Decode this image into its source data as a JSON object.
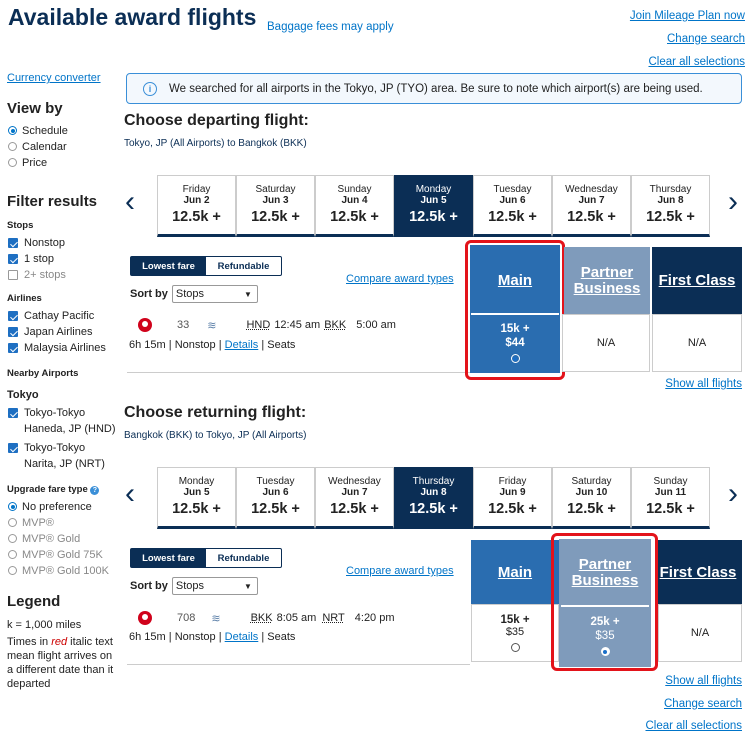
{
  "header": {
    "title": "Available award flights",
    "baggage": "Baggage fees may apply",
    "join": "Join Mileage Plan now",
    "change_search": "Change search",
    "clear": "Clear all selections"
  },
  "sidebar": {
    "currency": "Currency converter",
    "view_by": {
      "title": "View by",
      "options": [
        "Schedule",
        "Calendar",
        "Price"
      ],
      "selected": "Schedule"
    },
    "filter_title": "Filter results",
    "stops": {
      "title": "Stops",
      "options": [
        {
          "label": "Nonstop",
          "checked": true
        },
        {
          "label": "1 stop",
          "checked": true
        },
        {
          "label": "2+ stops",
          "checked": false
        }
      ]
    },
    "airlines": {
      "title": "Airlines",
      "options": [
        {
          "label": "Cathay Pacific",
          "checked": true
        },
        {
          "label": "Japan Airlines",
          "checked": true
        },
        {
          "label": "Malaysia Airlines",
          "checked": true
        }
      ]
    },
    "nearby": {
      "title": "Nearby Airports",
      "city": "Tokyo",
      "options": [
        {
          "label": "Tokyo-Tokyo Haneda, JP (HND)",
          "checked": true
        },
        {
          "label": "Tokyo-Tokyo Narita, JP (NRT)",
          "checked": true
        }
      ]
    },
    "upgrade": {
      "title": "Upgrade fare type",
      "options": [
        "No preference",
        "MVP®",
        "MVP® Gold",
        "MVP® Gold 75K",
        "MVP® Gold 100K"
      ],
      "selected": "No preference"
    },
    "legend": {
      "title": "Legend",
      "k": "k = 1,000 miles",
      "times_a": "Times in ",
      "times_red": "red",
      "times_b": " italic text mean flight arrives on a different date than it departed"
    }
  },
  "notice": "We searched for all airports in the Tokyo, JP (TYO) area. Be sure to note which airport(s) are being used.",
  "departing": {
    "title": "Choose departing flight:",
    "route": "Tokyo, JP (All Airports) to Bangkok (BKK)",
    "dates": [
      {
        "day": "Friday",
        "date": "Jun 2",
        "price": "12.5k +"
      },
      {
        "day": "Saturday",
        "date": "Jun 3",
        "price": "12.5k +"
      },
      {
        "day": "Sunday",
        "date": "Jun 4",
        "price": "12.5k +"
      },
      {
        "day": "Monday",
        "date": "Jun 5",
        "price": "12.5k +"
      },
      {
        "day": "Tuesday",
        "date": "Jun 6",
        "price": "12.5k +"
      },
      {
        "day": "Wednesday",
        "date": "Jun 7",
        "price": "12.5k +"
      },
      {
        "day": "Thursday",
        "date": "Jun 8",
        "price": "12.5k +"
      }
    ],
    "selected_index": 3,
    "toggle": [
      "Lowest fare",
      "Refundable"
    ],
    "sort_label": "Sort by",
    "sort_value": "Stops",
    "compare": "Compare award types",
    "cols": [
      "Main",
      "Partner Business",
      "First Class"
    ],
    "flight": {
      "num": "33",
      "from": "HND",
      "dep": "12:45 am",
      "to": "BKK",
      "arr": "5:00 am",
      "duration": "6h 15m",
      "stops": "Nonstop",
      "details": "Details",
      "seats": "Seats"
    },
    "fares": [
      {
        "miles": "15k +",
        "tax": "$44",
        "selected": true
      },
      {
        "text": "N/A"
      },
      {
        "text": "N/A"
      }
    ],
    "show_all": "Show all flights"
  },
  "returning": {
    "title": "Choose returning flight:",
    "route": "Bangkok (BKK) to Tokyo, JP (All Airports)",
    "dates": [
      {
        "day": "Monday",
        "date": "Jun 5",
        "price": "12.5k +"
      },
      {
        "day": "Tuesday",
        "date": "Jun 6",
        "price": "12.5k +"
      },
      {
        "day": "Wednesday",
        "date": "Jun 7",
        "price": "12.5k +"
      },
      {
        "day": "Thursday",
        "date": "Jun 8",
        "price": "12.5k +"
      },
      {
        "day": "Friday",
        "date": "Jun 9",
        "price": "12.5k +"
      },
      {
        "day": "Saturday",
        "date": "Jun 10",
        "price": "12.5k +"
      },
      {
        "day": "Sunday",
        "date": "Jun 11",
        "price": "12.5k +"
      }
    ],
    "selected_index": 3,
    "toggle": [
      "Lowest fare",
      "Refundable"
    ],
    "sort_label": "Sort by",
    "sort_value": "Stops",
    "compare": "Compare award types",
    "cols": [
      "Main",
      "Partner Business",
      "First Class"
    ],
    "flight": {
      "num": "708",
      "from": "BKK",
      "dep": "8:05 am",
      "to": "NRT",
      "arr": "4:20 pm",
      "duration": "6h 15m",
      "stops": "Nonstop",
      "details": "Details",
      "seats": "Seats"
    },
    "fares": [
      {
        "miles": "15k +",
        "tax": "$35",
        "selected": false
      },
      {
        "miles": "25k +",
        "tax": "$35",
        "selected": true
      },
      {
        "text": "N/A"
      }
    ],
    "show_all": "Show all flights",
    "change_search": "Change search",
    "clear": "Clear all selections"
  },
  "colors": {
    "navy": "#0b2e55",
    "main_blue": "#2a6db0",
    "partner_grey": "#7f9bbb",
    "highlight": "#e3131a"
  }
}
